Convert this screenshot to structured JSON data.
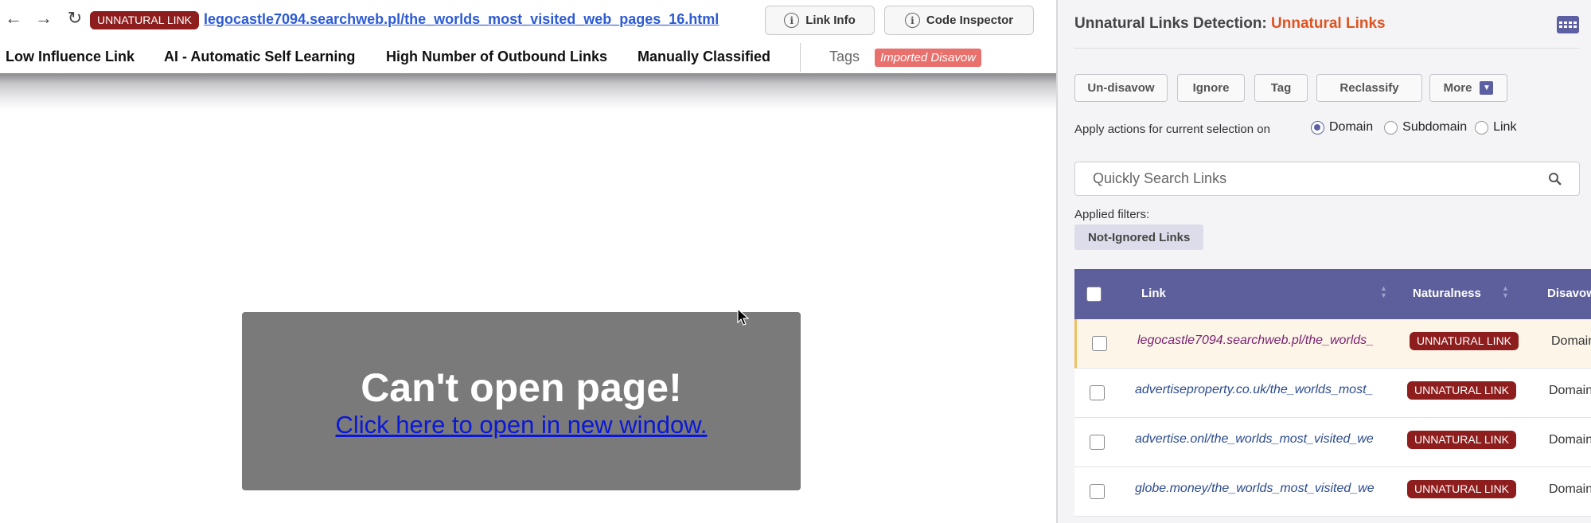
{
  "browser": {
    "back_icon": "arrow-left-icon",
    "forward_icon": "arrow-right-icon",
    "reload_icon": "reload-icon",
    "link_badge": "UNNATURAL LINK",
    "url": "legocastle7094.searchweb.pl/the_worlds_most_visited_web_pages_16.html",
    "link_info_label": "Link Info",
    "code_inspector_label": "Code Inspector"
  },
  "tagbar": {
    "tags": [
      "Low Influence Link",
      "AI - Automatic Self Learning",
      "High Number of Outbound Links",
      "Manually Classified"
    ],
    "tags_label": "Tags",
    "imported_label": "Imported Disavow"
  },
  "error": {
    "title": "Can't open page!",
    "link": "Click here to open in new window."
  },
  "panel": {
    "title_prefix": "Unnatural Links Detection:",
    "title_accent": "Unnatural Links",
    "actions": {
      "undisavow": "Un-disavow",
      "ignore": "Ignore",
      "tag": "Tag",
      "reclassify": "Reclassify",
      "more": "More"
    },
    "apply_label": "Apply actions for current selection on",
    "radios": [
      "Domain",
      "Subdomain",
      "Link"
    ],
    "search_placeholder": "Quickly Search Links",
    "filters_label": "Applied filters:",
    "filter_chip": "Not-Ignored Links",
    "table": {
      "headers": {
        "link": "Link",
        "naturalness": "Naturalness",
        "disavow": "Disavow"
      },
      "rows": [
        {
          "link": "legocastle7094.searchweb.pl/the_worlds_",
          "naturalness": "UNNATURAL LINK",
          "disavow": "Domain"
        },
        {
          "link": "advertiseproperty.co.uk/the_worlds_most_",
          "naturalness": "UNNATURAL LINK",
          "disavow": "Domain"
        },
        {
          "link": "advertise.onl/the_worlds_most_visited_we",
          "naturalness": "UNNATURAL LINK",
          "disavow": "Domain"
        },
        {
          "link": "globe.money/the_worlds_most_visited_we",
          "naturalness": "UNNATURAL LINK",
          "disavow": "Domain"
        }
      ]
    }
  },
  "colors": {
    "accent": "#e0531f",
    "header": "#5d5f9c",
    "badge": "#8e1d1d",
    "imported": "#e8716d"
  }
}
